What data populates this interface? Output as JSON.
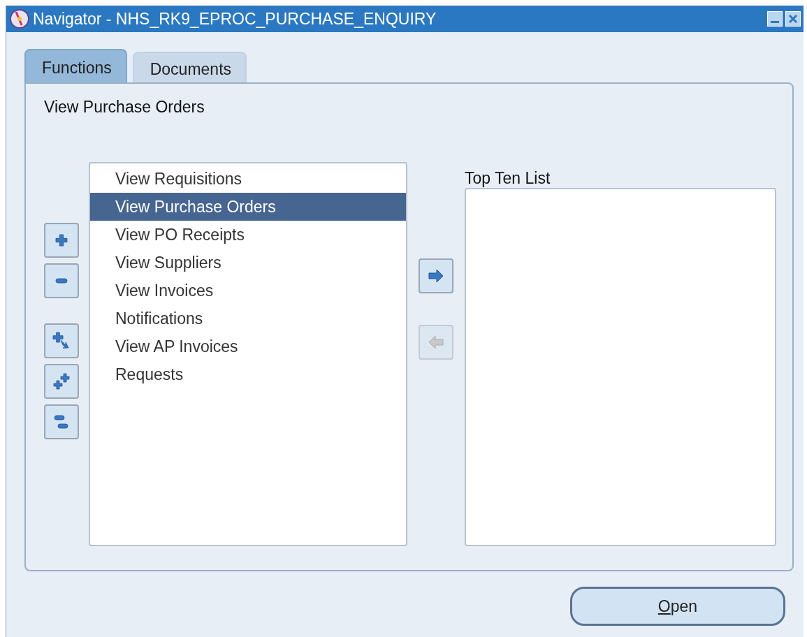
{
  "window": {
    "title": "Navigator - NHS_RK9_EPROC_PURCHASE_ENQUIRY"
  },
  "tabs": [
    {
      "label": "Functions",
      "selected": true
    },
    {
      "label": "Documents",
      "selected": false
    }
  ],
  "selected_function": "View Purchase Orders",
  "tree_buttons": [
    {
      "kind": "expand"
    },
    {
      "kind": "collapse"
    },
    {
      "kind": "expand-branch"
    },
    {
      "kind": "expand-all"
    },
    {
      "kind": "collapse-all"
    }
  ],
  "functions": [
    {
      "label": "View Requisitions",
      "selected": false
    },
    {
      "label": "View Purchase Orders",
      "selected": true
    },
    {
      "label": "View PO Receipts",
      "selected": false
    },
    {
      "label": "View Suppliers",
      "selected": false
    },
    {
      "label": "View Invoices",
      "selected": false
    },
    {
      "label": "Notifications",
      "selected": false
    },
    {
      "label": "View AP Invoices",
      "selected": false
    },
    {
      "label": "Requests",
      "selected": false
    }
  ],
  "transfer_buttons": [
    {
      "kind": "add",
      "disabled": false
    },
    {
      "kind": "remove",
      "disabled": true
    }
  ],
  "top_ten": {
    "label": "Top Ten List"
  },
  "open_button": {
    "label": "Open"
  }
}
